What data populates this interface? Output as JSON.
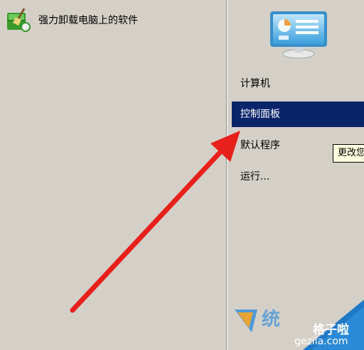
{
  "left_pane": {
    "programs": [
      {
        "label": "强力卸载电脑上的软件",
        "icon": "uninstall-broom-icon"
      }
    ]
  },
  "right_pane": {
    "user_picture_icon": "control-panel-monitor-icon",
    "items": [
      {
        "label": "计算机",
        "highlighted": false
      },
      {
        "label": "控制面板",
        "highlighted": true
      },
      {
        "label": "默认程序",
        "highlighted": false
      },
      {
        "label": "运行...",
        "highlighted": false
      }
    ]
  },
  "tooltip": {
    "text": "更改您"
  },
  "watermark": {
    "brand": "格子啦",
    "url": "gezila.com"
  },
  "colors": {
    "background": "#d4d0c8",
    "highlight": "#0a246a",
    "arrow": "#e8201b",
    "tooltip_bg": "#ffffe1"
  }
}
